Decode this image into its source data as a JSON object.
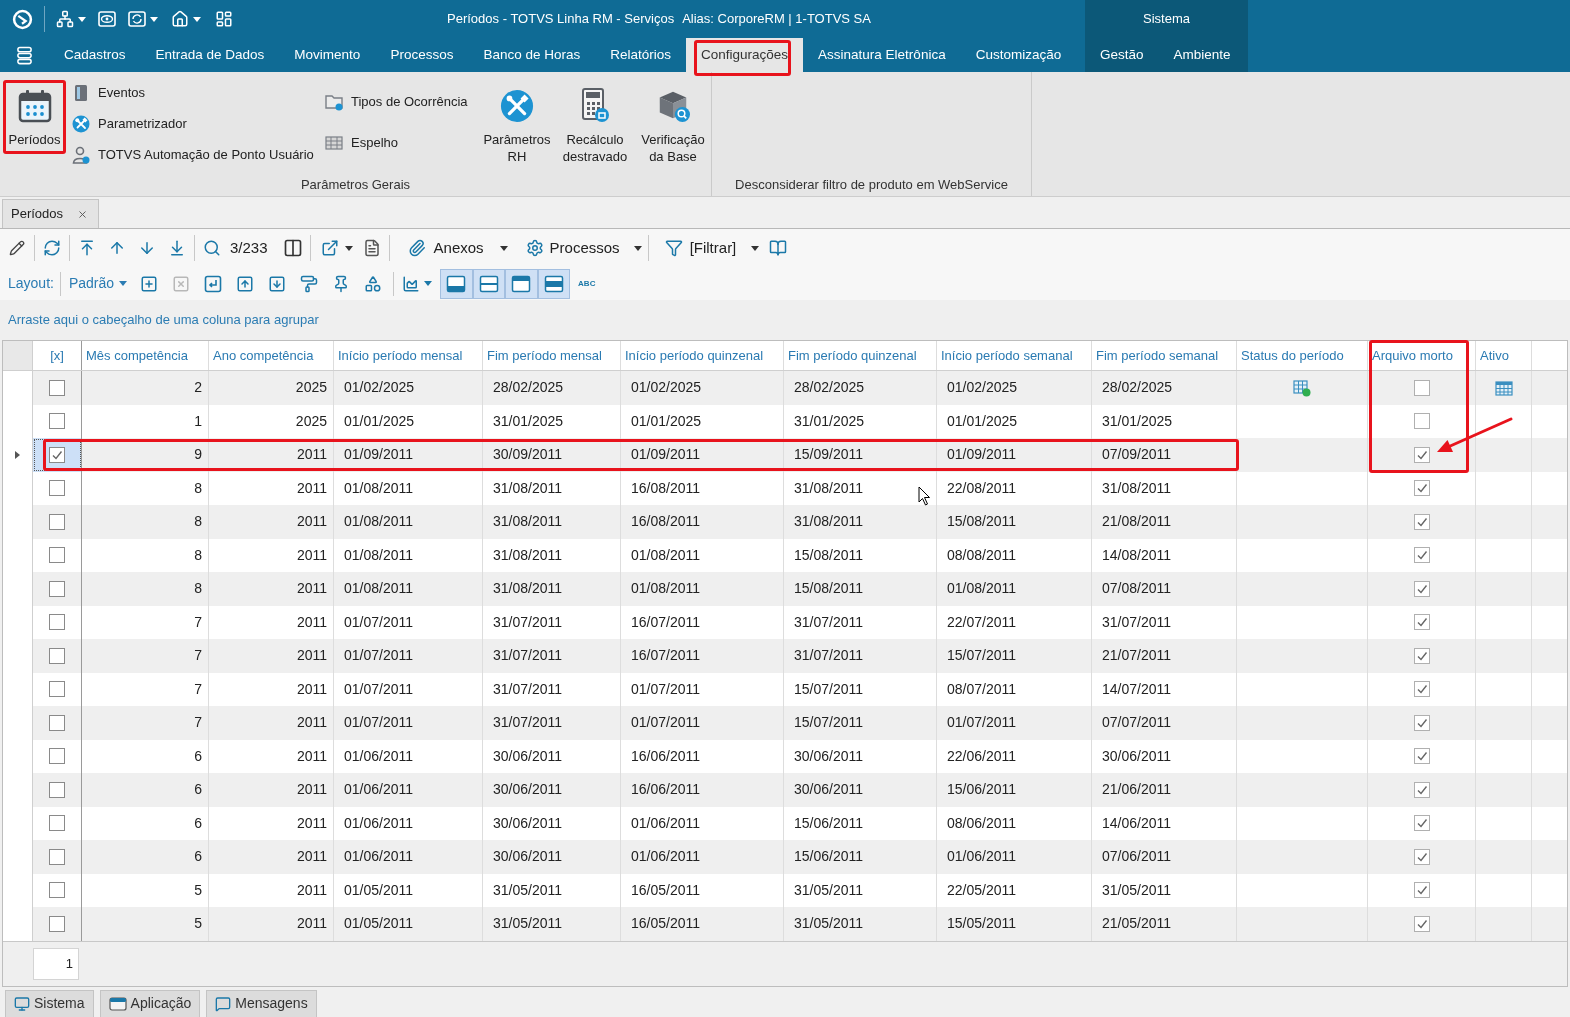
{
  "window": {
    "title": "Períodos - TOTVS Linha RM - Serviços",
    "alias": "Alias: CorporeRM | 1-TOTVS SA"
  },
  "menu": {
    "tabs": [
      {
        "label": "Cadastros",
        "selected": false,
        "highlighted": false
      },
      {
        "label": "Entrada de Dados",
        "selected": false,
        "highlighted": false
      },
      {
        "label": "Movimento",
        "selected": false,
        "highlighted": false
      },
      {
        "label": "Processos",
        "selected": false,
        "highlighted": false
      },
      {
        "label": "Banco de Horas",
        "selected": false,
        "highlighted": false
      },
      {
        "label": "Relatórios",
        "selected": false,
        "highlighted": false
      },
      {
        "label": "Configurações",
        "selected": true,
        "highlighted": true
      },
      {
        "label": "Assinatura Eletrônica",
        "selected": false,
        "highlighted": false
      },
      {
        "label": "Customização",
        "selected": false,
        "highlighted": false
      }
    ],
    "system_group": {
      "title": "Sistema",
      "tabs": [
        {
          "label": "Gestão",
          "selected": false
        },
        {
          "label": "Ambiente",
          "selected": false
        }
      ]
    }
  },
  "ribbon": {
    "groups": [
      {
        "label": "Parâmetros Gerais",
        "items": [
          {
            "kind": "large",
            "label": "Períodos",
            "highlighted": true
          },
          {
            "kind": "stack",
            "buttons": [
              {
                "label": "Eventos"
              },
              {
                "label": "Parametrizador"
              },
              {
                "label": "TOTVS Automação de Ponto Usuário"
              }
            ]
          },
          {
            "kind": "stack",
            "buttons": [
              {
                "label": "Tipos de Ocorrência"
              },
              {
                "label": "Espelho"
              }
            ]
          },
          {
            "kind": "large",
            "label": "Parâmetros RH",
            "highlighted": false
          },
          {
            "kind": "large",
            "label": "Recálculo destravado",
            "highlighted": false
          },
          {
            "kind": "large",
            "label": "Verificação da Base",
            "highlighted": false
          }
        ]
      },
      {
        "label": "Desconsiderar filtro de produto em WebService"
      }
    ]
  },
  "doc_tabs": [
    {
      "label": "Períodos",
      "selected": true
    }
  ],
  "toolbar": {
    "record_counter": "3/233",
    "attachments": "Anexos",
    "processes": "Processos",
    "filter": "[Filtrar]"
  },
  "layout_bar": {
    "label": "Layout:",
    "layout": "Padrão",
    "delete_disabled": true,
    "view_toggles": [
      {
        "on": true
      },
      {
        "on": true
      },
      {
        "on": true
      },
      {
        "on": true
      }
    ],
    "spell_label": "ABC"
  },
  "group_panel": {
    "hint": "Arraste aqui o cabeçalho de uma coluna para agrupar"
  },
  "table": {
    "columns": [
      {
        "label": "[x]",
        "kind": "check",
        "highlighted": false
      },
      {
        "label": "Mês competência",
        "kind": "number",
        "highlighted": false
      },
      {
        "label": "Ano competência",
        "kind": "number",
        "highlighted": false
      },
      {
        "label": "Início período mensal",
        "kind": "date",
        "highlighted": false
      },
      {
        "label": "Fim período mensal",
        "kind": "date",
        "highlighted": false
      },
      {
        "label": "Início período quinzenal",
        "kind": "date",
        "highlighted": false
      },
      {
        "label": "Fim período quinzenal",
        "kind": "date",
        "highlighted": false
      },
      {
        "label": "Início período semanal",
        "kind": "date",
        "highlighted": false
      },
      {
        "label": "Fim período semanal",
        "kind": "date",
        "highlighted": false
      },
      {
        "label": "Status do período",
        "kind": "status",
        "highlighted": false
      },
      {
        "label": "Arquivo morto",
        "kind": "check",
        "highlighted": true
      },
      {
        "label": "Ativo",
        "kind": "active",
        "highlighted": false
      }
    ],
    "rows": [
      {
        "selected": false,
        "highlighted": false,
        "arrow": false,
        "cells": [
          false,
          "2",
          "2025",
          "01/02/2025",
          "28/02/2025",
          "01/02/2025",
          "28/02/2025",
          "01/02/2025",
          "28/02/2025",
          true,
          false,
          true
        ]
      },
      {
        "selected": false,
        "highlighted": false,
        "arrow": false,
        "cells": [
          false,
          "1",
          "2025",
          "01/01/2025",
          "31/01/2025",
          "01/01/2025",
          "31/01/2025",
          "01/01/2025",
          "31/01/2025",
          false,
          false,
          false
        ]
      },
      {
        "selected": true,
        "highlighted": true,
        "arrow": true,
        "cells": [
          true,
          "9",
          "2011",
          "01/09/2011",
          "30/09/2011",
          "01/09/2011",
          "15/09/2011",
          "01/09/2011",
          "07/09/2011",
          false,
          true,
          false
        ]
      },
      {
        "selected": false,
        "highlighted": false,
        "arrow": false,
        "cells": [
          false,
          "8",
          "2011",
          "01/08/2011",
          "31/08/2011",
          "16/08/2011",
          "31/08/2011",
          "22/08/2011",
          "31/08/2011",
          false,
          true,
          false
        ]
      },
      {
        "selected": false,
        "highlighted": false,
        "arrow": false,
        "cells": [
          false,
          "8",
          "2011",
          "01/08/2011",
          "31/08/2011",
          "16/08/2011",
          "31/08/2011",
          "15/08/2011",
          "21/08/2011",
          false,
          true,
          false
        ]
      },
      {
        "selected": false,
        "highlighted": false,
        "arrow": false,
        "cells": [
          false,
          "8",
          "2011",
          "01/08/2011",
          "31/08/2011",
          "01/08/2011",
          "15/08/2011",
          "08/08/2011",
          "14/08/2011",
          false,
          true,
          false
        ]
      },
      {
        "selected": false,
        "highlighted": false,
        "arrow": false,
        "cells": [
          false,
          "8",
          "2011",
          "01/08/2011",
          "31/08/2011",
          "01/08/2011",
          "15/08/2011",
          "01/08/2011",
          "07/08/2011",
          false,
          true,
          false
        ]
      },
      {
        "selected": false,
        "highlighted": false,
        "arrow": false,
        "cells": [
          false,
          "7",
          "2011",
          "01/07/2011",
          "31/07/2011",
          "16/07/2011",
          "31/07/2011",
          "22/07/2011",
          "31/07/2011",
          false,
          true,
          false
        ]
      },
      {
        "selected": false,
        "highlighted": false,
        "arrow": false,
        "cells": [
          false,
          "7",
          "2011",
          "01/07/2011",
          "31/07/2011",
          "16/07/2011",
          "31/07/2011",
          "15/07/2011",
          "21/07/2011",
          false,
          true,
          false
        ]
      },
      {
        "selected": false,
        "highlighted": false,
        "arrow": false,
        "cells": [
          false,
          "7",
          "2011",
          "01/07/2011",
          "31/07/2011",
          "01/07/2011",
          "15/07/2011",
          "08/07/2011",
          "14/07/2011",
          false,
          true,
          false
        ]
      },
      {
        "selected": false,
        "highlighted": false,
        "arrow": false,
        "cells": [
          false,
          "7",
          "2011",
          "01/07/2011",
          "31/07/2011",
          "01/07/2011",
          "15/07/2011",
          "01/07/2011",
          "07/07/2011",
          false,
          true,
          false
        ]
      },
      {
        "selected": false,
        "highlighted": false,
        "arrow": false,
        "cells": [
          false,
          "6",
          "2011",
          "01/06/2011",
          "30/06/2011",
          "16/06/2011",
          "30/06/2011",
          "22/06/2011",
          "30/06/2011",
          false,
          true,
          false
        ]
      },
      {
        "selected": false,
        "highlighted": false,
        "arrow": false,
        "cells": [
          false,
          "6",
          "2011",
          "01/06/2011",
          "30/06/2011",
          "16/06/2011",
          "30/06/2011",
          "15/06/2011",
          "21/06/2011",
          false,
          true,
          false
        ]
      },
      {
        "selected": false,
        "highlighted": false,
        "arrow": false,
        "cells": [
          false,
          "6",
          "2011",
          "01/06/2011",
          "30/06/2011",
          "01/06/2011",
          "15/06/2011",
          "08/06/2011",
          "14/06/2011",
          false,
          true,
          false
        ]
      },
      {
        "selected": false,
        "highlighted": false,
        "arrow": false,
        "cells": [
          false,
          "6",
          "2011",
          "01/06/2011",
          "30/06/2011",
          "01/06/2011",
          "15/06/2011",
          "01/06/2011",
          "07/06/2011",
          false,
          true,
          false
        ]
      },
      {
        "selected": false,
        "highlighted": false,
        "arrow": false,
        "cells": [
          false,
          "5",
          "2011",
          "01/05/2011",
          "31/05/2011",
          "16/05/2011",
          "31/05/2011",
          "22/05/2011",
          "31/05/2011",
          false,
          true,
          false
        ]
      },
      {
        "selected": false,
        "highlighted": false,
        "arrow": false,
        "cells": [
          false,
          "5",
          "2011",
          "01/05/2011",
          "31/05/2011",
          "16/05/2011",
          "31/05/2011",
          "15/05/2011",
          "21/05/2011",
          false,
          true,
          false
        ]
      }
    ]
  },
  "footer": {
    "page": "1"
  },
  "status_tabs": [
    {
      "label": "Sistema"
    },
    {
      "label": "Aplicação"
    },
    {
      "label": "Mensagens"
    }
  ]
}
